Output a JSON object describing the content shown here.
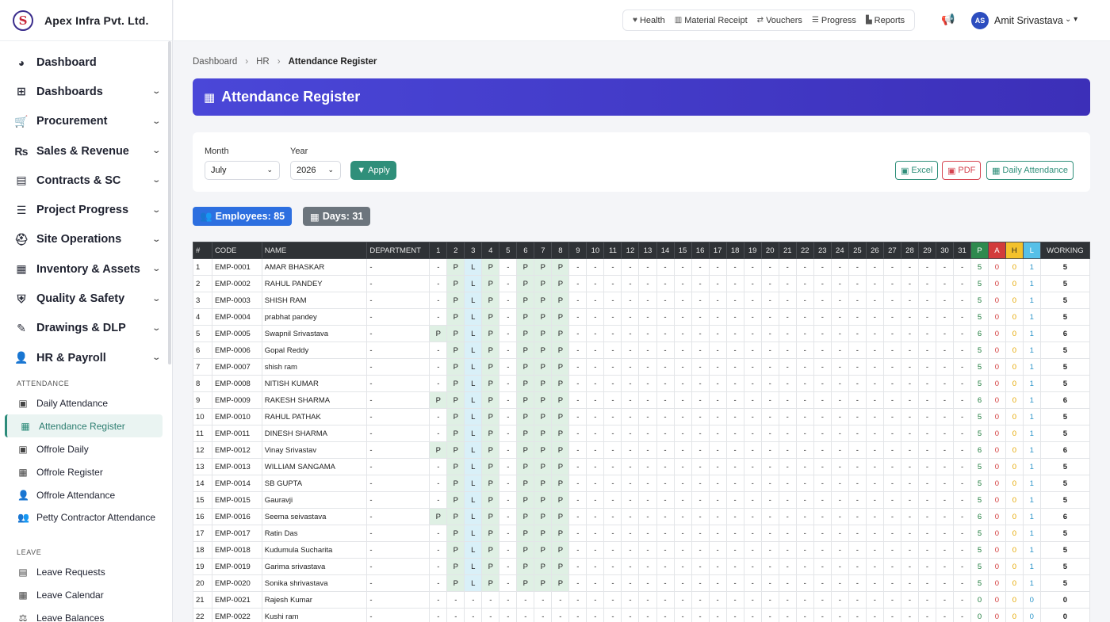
{
  "brand": {
    "name": "Apex Infra Pvt. Ltd.",
    "logo_letter": "S"
  },
  "sidebar": {
    "items": [
      {
        "label": "Dashboard",
        "icon": "palette-icon",
        "glyph": "◕",
        "chevron": false
      },
      {
        "label": "Dashboards",
        "icon": "grid-icon",
        "glyph": "⊞",
        "chevron": true
      },
      {
        "label": "Procurement",
        "icon": "cart-icon",
        "glyph": "🛒",
        "chevron": true
      },
      {
        "label": "Sales & Revenue",
        "icon": "rupee-icon",
        "glyph": "₨",
        "chevron": true
      },
      {
        "label": "Contracts & SC",
        "icon": "file-contract-icon",
        "glyph": "▤",
        "chevron": true
      },
      {
        "label": "Project Progress",
        "icon": "list-check-icon",
        "glyph": "☰",
        "chevron": true
      },
      {
        "label": "Site Operations",
        "icon": "hard-hat-icon",
        "glyph": "⛑",
        "chevron": true
      },
      {
        "label": "Inventory & Assets",
        "icon": "boxes-icon",
        "glyph": "▦",
        "chevron": true
      },
      {
        "label": "Quality & Safety",
        "icon": "shield-icon",
        "glyph": "⛨",
        "chevron": true
      },
      {
        "label": "Drawings & DLP",
        "icon": "drafting-icon",
        "glyph": "✎",
        "chevron": true
      },
      {
        "label": "HR & Payroll",
        "icon": "user-tie-icon",
        "glyph": "👤",
        "chevron": true
      }
    ],
    "section_attendance": "ATTENDANCE",
    "attendance_items": [
      {
        "label": "Daily Attendance",
        "icon": "clipboard-check-icon",
        "glyph": "▣",
        "active": false
      },
      {
        "label": "Attendance Register",
        "icon": "calendar-icon",
        "glyph": "▦",
        "active": true
      },
      {
        "label": "Offrole Daily",
        "icon": "clipboard-check-icon",
        "glyph": "▣",
        "active": false
      },
      {
        "label": "Offrole Register",
        "icon": "calendar-icon",
        "glyph": "▦",
        "active": false
      },
      {
        "label": "Offrole Attendance",
        "icon": "user-check-icon",
        "glyph": "👤",
        "active": false
      },
      {
        "label": "Petty Contractor Attendance",
        "icon": "users-icon",
        "glyph": "👥",
        "active": false
      }
    ],
    "section_leave": "LEAVE",
    "leave_items": [
      {
        "label": "Leave Requests",
        "icon": "calendar-minus-icon",
        "glyph": "▤"
      },
      {
        "label": "Leave Calendar",
        "icon": "calendar-icon",
        "glyph": "▦"
      },
      {
        "label": "Leave Balances",
        "icon": "balance-scale-icon",
        "glyph": "⚖"
      }
    ]
  },
  "topbar": {
    "quick_links": [
      {
        "label": "Health",
        "icon": "heart-pulse-icon",
        "glyph": "♥"
      },
      {
        "label": "Material Receipt",
        "icon": "truck-loading-icon",
        "glyph": "▥"
      },
      {
        "label": "Vouchers",
        "icon": "exchange-icon",
        "glyph": "⇄"
      },
      {
        "label": "Progress",
        "icon": "tasks-icon",
        "glyph": "☰"
      },
      {
        "label": "Reports",
        "icon": "chart-icon",
        "glyph": "▙"
      }
    ],
    "user_initials": "AS",
    "user_name": "Amit Srivastava"
  },
  "breadcrumb": {
    "items": [
      "Dashboard",
      "HR"
    ],
    "current": "Attendance Register"
  },
  "page_title": "Attendance Register",
  "filters": {
    "month_label": "Month",
    "month_value": "July",
    "year_label": "Year",
    "year_value": "2026",
    "apply_label": "Apply",
    "excel_label": "Excel",
    "pdf_label": "PDF",
    "daily_label": "Daily Attendance"
  },
  "badges": {
    "employees": "Employees: 85",
    "days": "Days: 31"
  },
  "colors": {
    "accent": "#2f8f7a",
    "banner": "#4a47d8",
    "present": "#2e8a4e",
    "absent": "#d23b3b",
    "half": "#f3c12b",
    "leave": "#56c0e8"
  },
  "table": {
    "headers": {
      "num": "#",
      "code": "CODE",
      "name": "NAME",
      "department": "DEPARTMENT",
      "p": "P",
      "a": "A",
      "h": "H",
      "l": "L",
      "working": "WORKING"
    },
    "day_count": 31,
    "pattern_base": [
      "-",
      "P",
      "L",
      "P",
      "-",
      "P",
      "P",
      "P"
    ],
    "pattern_full": [
      "P",
      "P",
      "L",
      "P",
      "-",
      "P",
      "P",
      "P"
    ],
    "rows": [
      {
        "n": "1",
        "code": "EMP-0001",
        "name": "AMAR BHASKAR",
        "dept": "-",
        "pat": "base",
        "p": "5",
        "a": "0",
        "h": "0",
        "l": "1",
        "w": "5"
      },
      {
        "n": "2",
        "code": "EMP-0002",
        "name": "RAHUL PANDEY",
        "dept": "-",
        "pat": "base",
        "p": "5",
        "a": "0",
        "h": "0",
        "l": "1",
        "w": "5"
      },
      {
        "n": "3",
        "code": "EMP-0003",
        "name": "SHISH RAM",
        "dept": "-",
        "pat": "base",
        "p": "5",
        "a": "0",
        "h": "0",
        "l": "1",
        "w": "5"
      },
      {
        "n": "4",
        "code": "EMP-0004",
        "name": "prabhat pandey",
        "dept": "-",
        "pat": "base",
        "p": "5",
        "a": "0",
        "h": "0",
        "l": "1",
        "w": "5"
      },
      {
        "n": "5",
        "code": "EMP-0005",
        "name": "Swapnil Srivastava",
        "dept": "-",
        "pat": "full",
        "p": "6",
        "a": "0",
        "h": "0",
        "l": "1",
        "w": "6"
      },
      {
        "n": "6",
        "code": "EMP-0006",
        "name": "Gopal Reddy",
        "dept": "-",
        "pat": "base",
        "p": "5",
        "a": "0",
        "h": "0",
        "l": "1",
        "w": "5"
      },
      {
        "n": "7",
        "code": "EMP-0007",
        "name": "shish ram",
        "dept": "-",
        "pat": "base",
        "p": "5",
        "a": "0",
        "h": "0",
        "l": "1",
        "w": "5"
      },
      {
        "n": "8",
        "code": "EMP-0008",
        "name": "NITISH KUMAR",
        "dept": "-",
        "pat": "base",
        "p": "5",
        "a": "0",
        "h": "0",
        "l": "1",
        "w": "5"
      },
      {
        "n": "9",
        "code": "EMP-0009",
        "name": "RAKESH SHARMA",
        "dept": "-",
        "pat": "full",
        "p": "6",
        "a": "0",
        "h": "0",
        "l": "1",
        "w": "6"
      },
      {
        "n": "10",
        "code": "EMP-0010",
        "name": "RAHUL PATHAK",
        "dept": "-",
        "pat": "base",
        "p": "5",
        "a": "0",
        "h": "0",
        "l": "1",
        "w": "5"
      },
      {
        "n": "11",
        "code": "EMP-0011",
        "name": "DINESH SHARMA",
        "dept": "-",
        "pat": "base",
        "p": "5",
        "a": "0",
        "h": "0",
        "l": "1",
        "w": "5"
      },
      {
        "n": "12",
        "code": "EMP-0012",
        "name": "Vinay Srivastav",
        "dept": "-",
        "pat": "full",
        "p": "6",
        "a": "0",
        "h": "0",
        "l": "1",
        "w": "6"
      },
      {
        "n": "13",
        "code": "EMP-0013",
        "name": "WILLIAM SANGAMA",
        "dept": "-",
        "pat": "base",
        "p": "5",
        "a": "0",
        "h": "0",
        "l": "1",
        "w": "5"
      },
      {
        "n": "14",
        "code": "EMP-0014",
        "name": "SB GUPTA",
        "dept": "-",
        "pat": "base",
        "p": "5",
        "a": "0",
        "h": "0",
        "l": "1",
        "w": "5"
      },
      {
        "n": "15",
        "code": "EMP-0015",
        "name": "Gauravji",
        "dept": "-",
        "pat": "base",
        "p": "5",
        "a": "0",
        "h": "0",
        "l": "1",
        "w": "5"
      },
      {
        "n": "16",
        "code": "EMP-0016",
        "name": "Seema seivastava",
        "dept": "-",
        "pat": "full",
        "p": "6",
        "a": "0",
        "h": "0",
        "l": "1",
        "w": "6"
      },
      {
        "n": "17",
        "code": "EMP-0017",
        "name": "Ratin Das",
        "dept": "-",
        "pat": "base",
        "p": "5",
        "a": "0",
        "h": "0",
        "l": "1",
        "w": "5"
      },
      {
        "n": "18",
        "code": "EMP-0018",
        "name": "Kudumula Sucharita",
        "dept": "-",
        "pat": "base",
        "p": "5",
        "a": "0",
        "h": "0",
        "l": "1",
        "w": "5"
      },
      {
        "n": "19",
        "code": "EMP-0019",
        "name": "Garima srivastava",
        "dept": "-",
        "pat": "base",
        "p": "5",
        "a": "0",
        "h": "0",
        "l": "1",
        "w": "5"
      },
      {
        "n": "20",
        "code": "EMP-0020",
        "name": "Sonika shrivastava",
        "dept": "-",
        "pat": "base",
        "p": "5",
        "a": "0",
        "h": "0",
        "l": "1",
        "w": "5"
      },
      {
        "n": "21",
        "code": "EMP-0021",
        "name": "Rajesh Kumar",
        "dept": "-",
        "pat": "none",
        "p": "0",
        "a": "0",
        "h": "0",
        "l": "0",
        "w": "0"
      },
      {
        "n": "22",
        "code": "EMP-0022",
        "name": "Kushi ram",
        "dept": "-",
        "pat": "none",
        "p": "0",
        "a": "0",
        "h": "0",
        "l": "0",
        "w": "0"
      }
    ]
  }
}
